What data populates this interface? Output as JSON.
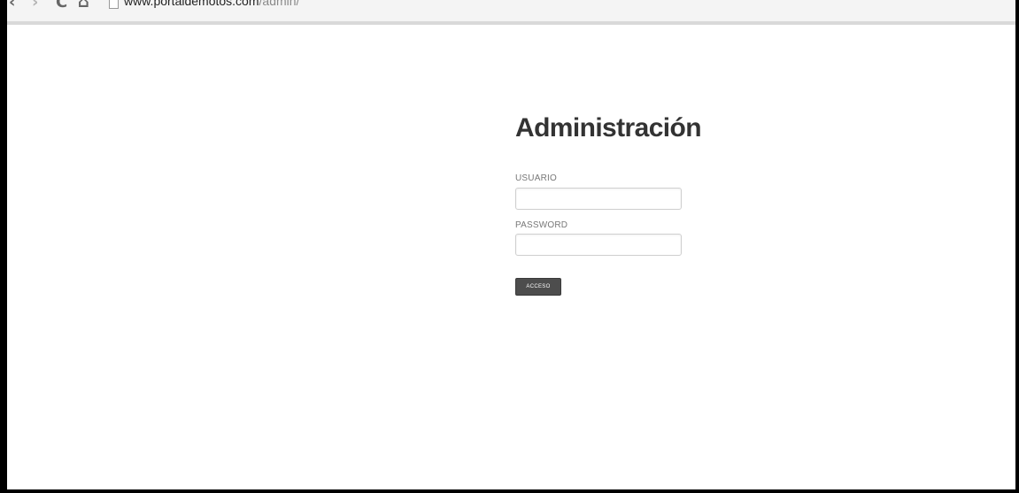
{
  "browser": {
    "url_host": "www.portaldemotos.com",
    "url_path": "/admin/",
    "back_glyph": "‹",
    "forward_glyph": "›",
    "reload_glyph": "C",
    "home_glyph": "⌂"
  },
  "login": {
    "title": "Administración",
    "username_label": "USUARIO",
    "username_value": "",
    "password_label": "PASSWORD",
    "password_value": "",
    "submit_label": "ACCESO"
  },
  "colors": {
    "title": "#333333",
    "button_bg": "#4d4d4d",
    "label": "#777777",
    "input_border": "#cfcfcf"
  }
}
